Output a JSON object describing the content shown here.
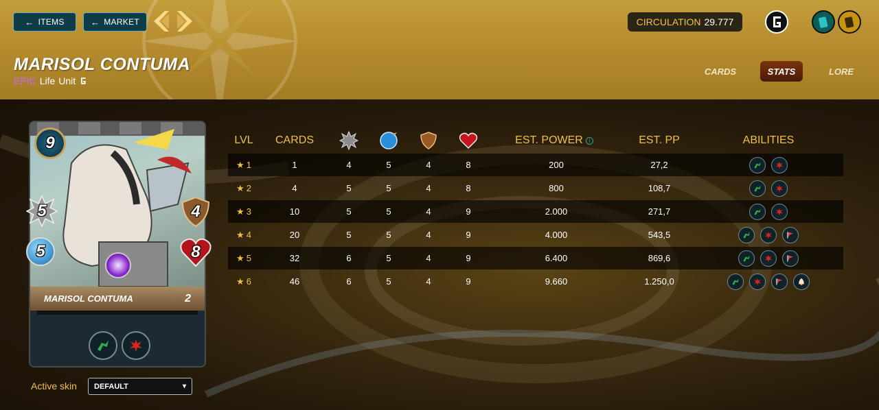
{
  "nav": {
    "items_label": "ITEMS",
    "market_label": "MARKET"
  },
  "circulation": {
    "label": "CIRCULATION",
    "value": "29.777"
  },
  "card": {
    "title": "MARISOL CONTUMA",
    "rarity": "EPIC",
    "element": "Life",
    "type": "Unit",
    "name_on_card": "MARISOL CONTUMA",
    "level": "2",
    "mana": "9",
    "melee": "5",
    "speed": "5",
    "armor": "4",
    "health": "8"
  },
  "tabs": [
    {
      "label": "CARDS",
      "active": false
    },
    {
      "label": "STATS",
      "active": true
    },
    {
      "label": "LORE",
      "active": false
    }
  ],
  "skin": {
    "label": "Active skin",
    "value": "DEFAULT"
  },
  "table": {
    "headers": {
      "lvl": "LVL",
      "cards": "CARDS",
      "power": "EST. POWER",
      "pp": "EST. PP",
      "abilities": "ABILITIES"
    },
    "stat_icons": [
      "attack-icon",
      "speed-icon",
      "armor-icon",
      "health-icon"
    ],
    "rows": [
      {
        "lvl": "1",
        "cards": "1",
        "attack": "4",
        "speed": "5",
        "armor": "4",
        "health": "8",
        "power": "200",
        "pp": "27,2",
        "abilities": [
          "trample",
          "enrage"
        ]
      },
      {
        "lvl": "2",
        "cards": "4",
        "attack": "5",
        "speed": "5",
        "armor": "4",
        "health": "8",
        "power": "800",
        "pp": "108,7",
        "abilities": [
          "trample",
          "enrage"
        ]
      },
      {
        "lvl": "3",
        "cards": "10",
        "attack": "5",
        "speed": "5",
        "armor": "4",
        "health": "9",
        "power": "2.000",
        "pp": "271,7",
        "abilities": [
          "trample",
          "enrage"
        ]
      },
      {
        "lvl": "4",
        "cards": "20",
        "attack": "5",
        "speed": "5",
        "armor": "4",
        "health": "9",
        "power": "4.000",
        "pp": "543,5",
        "abilities": [
          "trample",
          "enrage",
          "inspire"
        ]
      },
      {
        "lvl": "5",
        "cards": "32",
        "attack": "6",
        "speed": "5",
        "armor": "4",
        "health": "9",
        "power": "6.400",
        "pp": "869,6",
        "abilities": [
          "trample",
          "enrage",
          "inspire"
        ]
      },
      {
        "lvl": "6",
        "cards": "46",
        "attack": "6",
        "speed": "5",
        "armor": "4",
        "health": "9",
        "power": "9.660",
        "pp": "1.250,0",
        "abilities": [
          "trample",
          "enrage",
          "inspire",
          "shield"
        ]
      }
    ]
  },
  "colors": {
    "gold": "#f0c04a",
    "epic": "#c766ff",
    "nav_teal": "#0f3d47"
  }
}
